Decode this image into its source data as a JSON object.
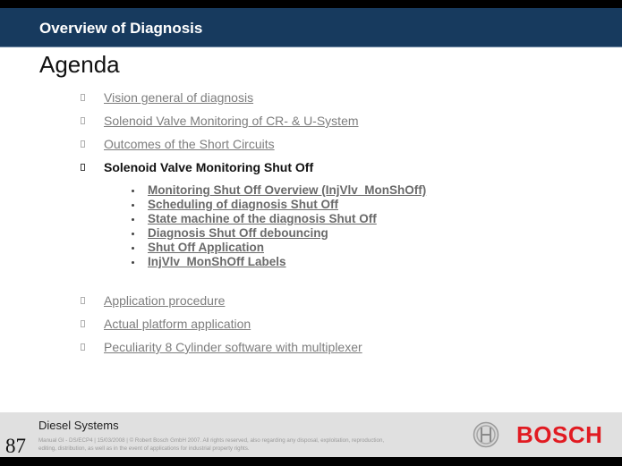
{
  "header": {
    "title": "Overview of Diagnosis"
  },
  "page_title": "Agenda",
  "agenda": {
    "items_before": [
      {
        "label": "Vision general of diagnosis"
      },
      {
        "label": "Solenoid Valve Monitoring of CR- & U-System"
      },
      {
        "label": "Outcomes of the Short Circuits"
      }
    ],
    "active_item": {
      "label": "Solenoid Valve Monitoring Shut Off"
    },
    "sub_items": [
      {
        "label": "Monitoring Shut Off Overview (InjVlv_MonShOff)"
      },
      {
        "label": "Scheduling of diagnosis Shut Off"
      },
      {
        "label": "State machine of the diagnosis Shut Off"
      },
      {
        "label": "Diagnosis Shut Off debouncing"
      },
      {
        "label": "Shut Off Application"
      },
      {
        "label": "InjVlv_MonShOff Labels"
      }
    ],
    "items_after": [
      {
        "label": "Application procedure"
      },
      {
        "label": "Actual platform application"
      },
      {
        "label": "Peculiarity 8 Cylinder software with multiplexer"
      }
    ]
  },
  "footer": {
    "company": "Diesel Systems",
    "page_number": "87",
    "legal_line1": "Manual GI - DS/ECP4 | 15/03/2008 | © Robert Bosch GmbH 2007. All rights reserved, also regarding any disposal, exploitation, reproduction,",
    "legal_line2": "editing, distribution, as well as in the event of applications for industrial property rights.",
    "brand": "BOSCH",
    "brand_color": "#e11b22"
  },
  "colors": {
    "header_band": "#173a5e",
    "link_text": "#7d7d7d",
    "active_text": "#111111"
  }
}
